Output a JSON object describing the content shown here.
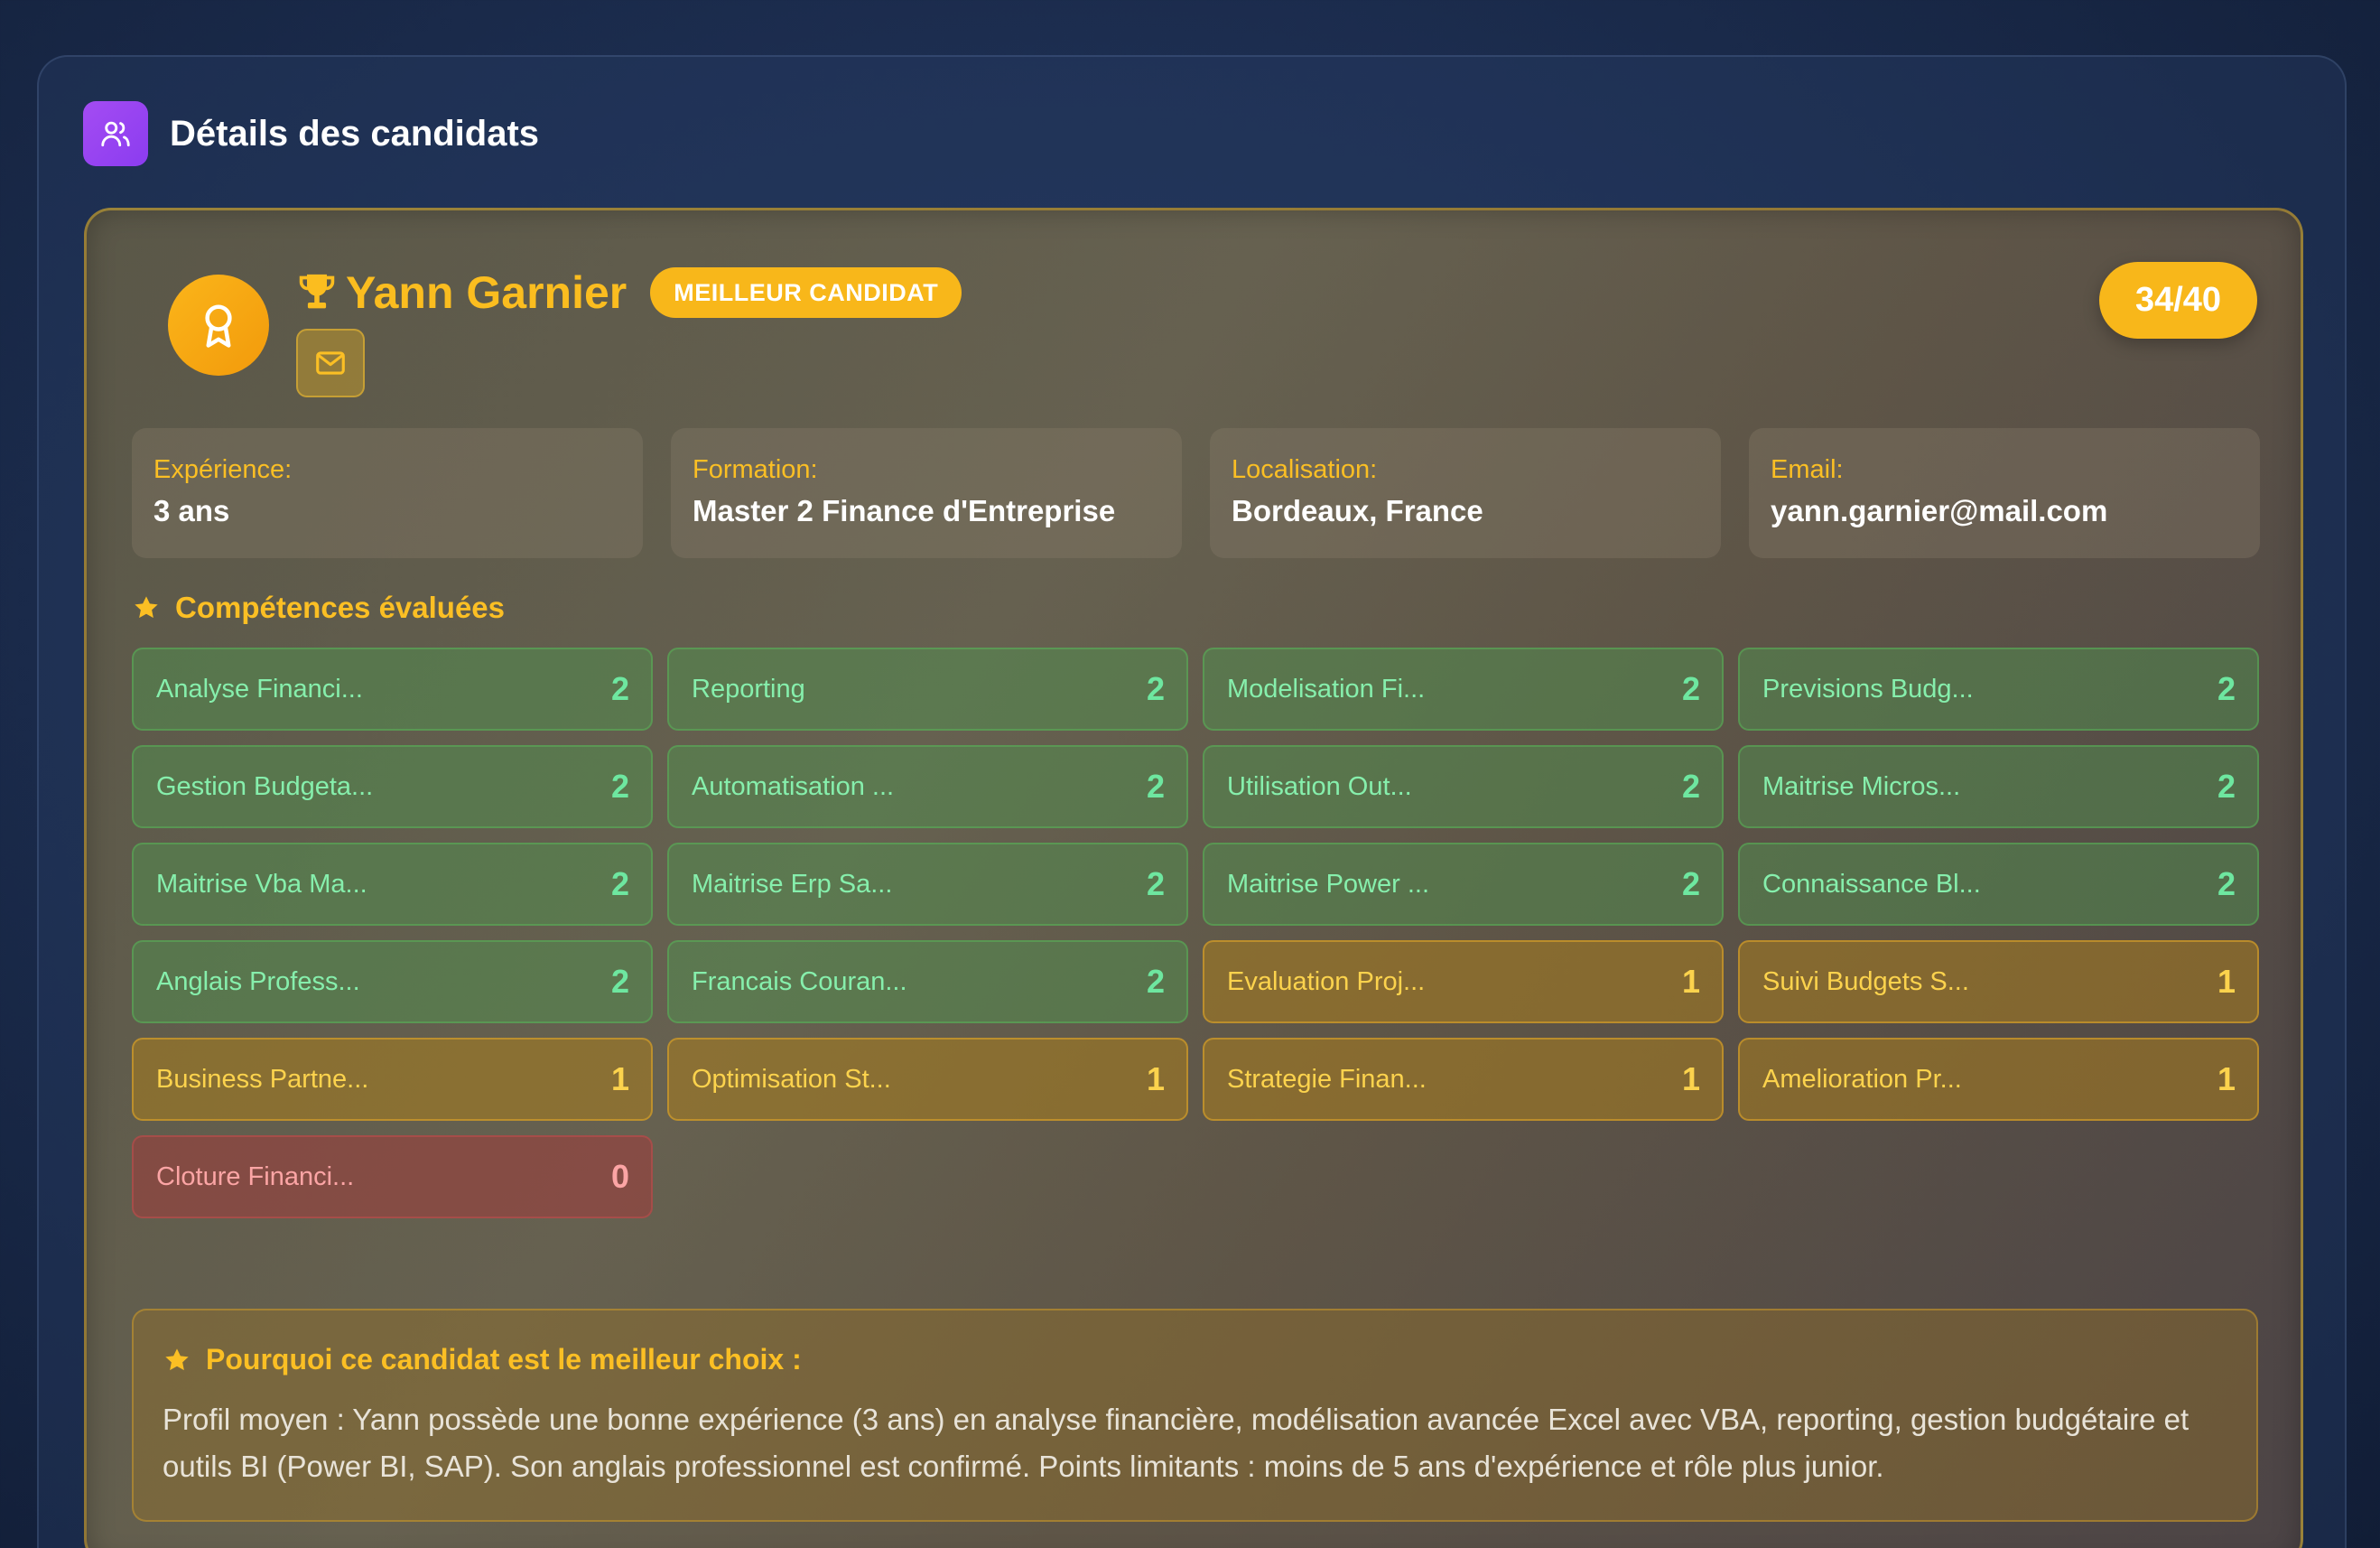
{
  "panel": {
    "title": "Détails des candidats",
    "icon": "users-icon"
  },
  "candidate": {
    "name": "Yann Garnier",
    "badge": "MEILLEUR CANDIDAT",
    "score": "34/40",
    "icons": {
      "avatar": "award-icon",
      "trophy": "trophy-icon",
      "mail": "mail-icon"
    }
  },
  "info": [
    {
      "label": "Expérience:",
      "value": "3 ans"
    },
    {
      "label": "Formation:",
      "value": "Master 2 Finance d'Entreprise"
    },
    {
      "label": "Localisation:",
      "value": "Bordeaux, France"
    },
    {
      "label": "Email:",
      "value": "yann.garnier@mail.com"
    }
  ],
  "skills_heading": "Compétences évaluées",
  "skills": [
    {
      "name": "Analyse Financi...",
      "score": "2"
    },
    {
      "name": "Reporting",
      "score": "2"
    },
    {
      "name": "Modelisation Fi...",
      "score": "2"
    },
    {
      "name": "Previsions Budg...",
      "score": "2"
    },
    {
      "name": "Gestion Budgeta...",
      "score": "2"
    },
    {
      "name": "Automatisation ...",
      "score": "2"
    },
    {
      "name": "Utilisation Out...",
      "score": "2"
    },
    {
      "name": "Maitrise Micros...",
      "score": "2"
    },
    {
      "name": "Maitrise Vba Ma...",
      "score": "2"
    },
    {
      "name": "Maitrise Erp Sa...",
      "score": "2"
    },
    {
      "name": "Maitrise Power ...",
      "score": "2"
    },
    {
      "name": "Connaissance Bl...",
      "score": "2"
    },
    {
      "name": "Anglais Profess...",
      "score": "2"
    },
    {
      "name": "Francais Couran...",
      "score": "2"
    },
    {
      "name": "Evaluation Proj...",
      "score": "1"
    },
    {
      "name": "Suivi Budgets S...",
      "score": "1"
    },
    {
      "name": "Business Partne...",
      "score": "1"
    },
    {
      "name": "Optimisation St...",
      "score": "1"
    },
    {
      "name": "Strategie Finan...",
      "score": "1"
    },
    {
      "name": "Amelioration Pr...",
      "score": "1"
    },
    {
      "name": "Cloture Financi...",
      "score": "0"
    }
  ],
  "why": {
    "title": "Pourquoi ce candidat est le meilleur choix :",
    "text": "Profil moyen : Yann possède une bonne expérience (3 ans) en analyse financière, modélisation avancée Excel avec VBA, reporting, gestion budgétaire et outils BI (Power BI, SAP). Son anglais professionnel est confirmé. Points limitants : moins de 5 ans d'expérience et rôle plus junior."
  },
  "colors": {
    "accent": "#fbbf24",
    "score_high": "#6ee7a0",
    "score_mid": "#fcd34d",
    "score_low": "#fca5a5",
    "header_icon_bg": "#9b45f1"
  }
}
